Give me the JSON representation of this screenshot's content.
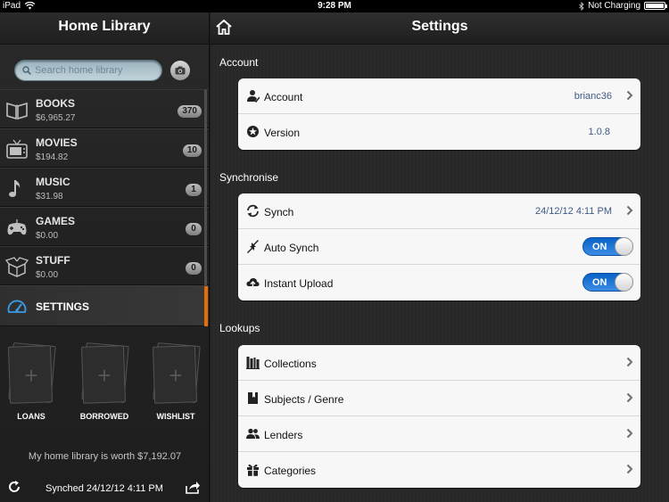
{
  "status_bar": {
    "device": "iPad",
    "time": "9:28 PM",
    "charging": "Not Charging"
  },
  "sidebar": {
    "title": "Home Library",
    "search_placeholder": "Search home library",
    "categories": [
      {
        "name": "BOOKS",
        "amount": "$6,965.27",
        "count": "370",
        "icon": "book-icon"
      },
      {
        "name": "MOVIES",
        "amount": "$194.82",
        "count": "10",
        "icon": "tv-icon"
      },
      {
        "name": "MUSIC",
        "amount": "$31.98",
        "count": "1",
        "icon": "music-note-icon"
      },
      {
        "name": "GAMES",
        "amount": "$0.00",
        "count": "0",
        "icon": "gamepad-icon"
      },
      {
        "name": "STUFF",
        "amount": "$0.00",
        "count": "0",
        "icon": "box-icon"
      }
    ],
    "settings_label": "SETTINGS",
    "shelves": [
      {
        "label": "LOANS"
      },
      {
        "label": "BORROWED"
      },
      {
        "label": "WISHLIST"
      }
    ],
    "worth_text": "My home library is worth $7,192.07",
    "synced_text": "Synched 24/12/12 4:11 PM",
    "active_color": "#e46c0a"
  },
  "main": {
    "title": "Settings",
    "sections": [
      {
        "title": "Account",
        "rows": [
          {
            "label": "Account",
            "value": "brianc36",
            "icon": "user-icon",
            "chevron": true
          },
          {
            "label": "Version",
            "value": "1.0.8",
            "icon": "star-badge-icon",
            "chevron": false
          }
        ]
      },
      {
        "title": "Synchronise",
        "rows": [
          {
            "label": "Synch",
            "value": "24/12/12 4:11 PM",
            "icon": "sync-icon",
            "chevron": true
          },
          {
            "label": "Auto Synch",
            "toggle": "ON",
            "icon": "auto-sync-icon"
          },
          {
            "label": "Instant Upload",
            "toggle": "ON",
            "icon": "cloud-upload-icon"
          }
        ]
      },
      {
        "title": "Lookups",
        "rows": [
          {
            "label": "Collections",
            "icon": "collections-icon",
            "chevron": true
          },
          {
            "label": "Subjects / Genre",
            "icon": "bookmark-book-icon",
            "chevron": true
          },
          {
            "label": "Lenders",
            "icon": "people-icon",
            "chevron": true
          },
          {
            "label": "Categories",
            "icon": "gift-icon",
            "chevron": true
          }
        ]
      }
    ],
    "toggle_color": "#1a73d9",
    "value_color": "#3d5a86"
  }
}
